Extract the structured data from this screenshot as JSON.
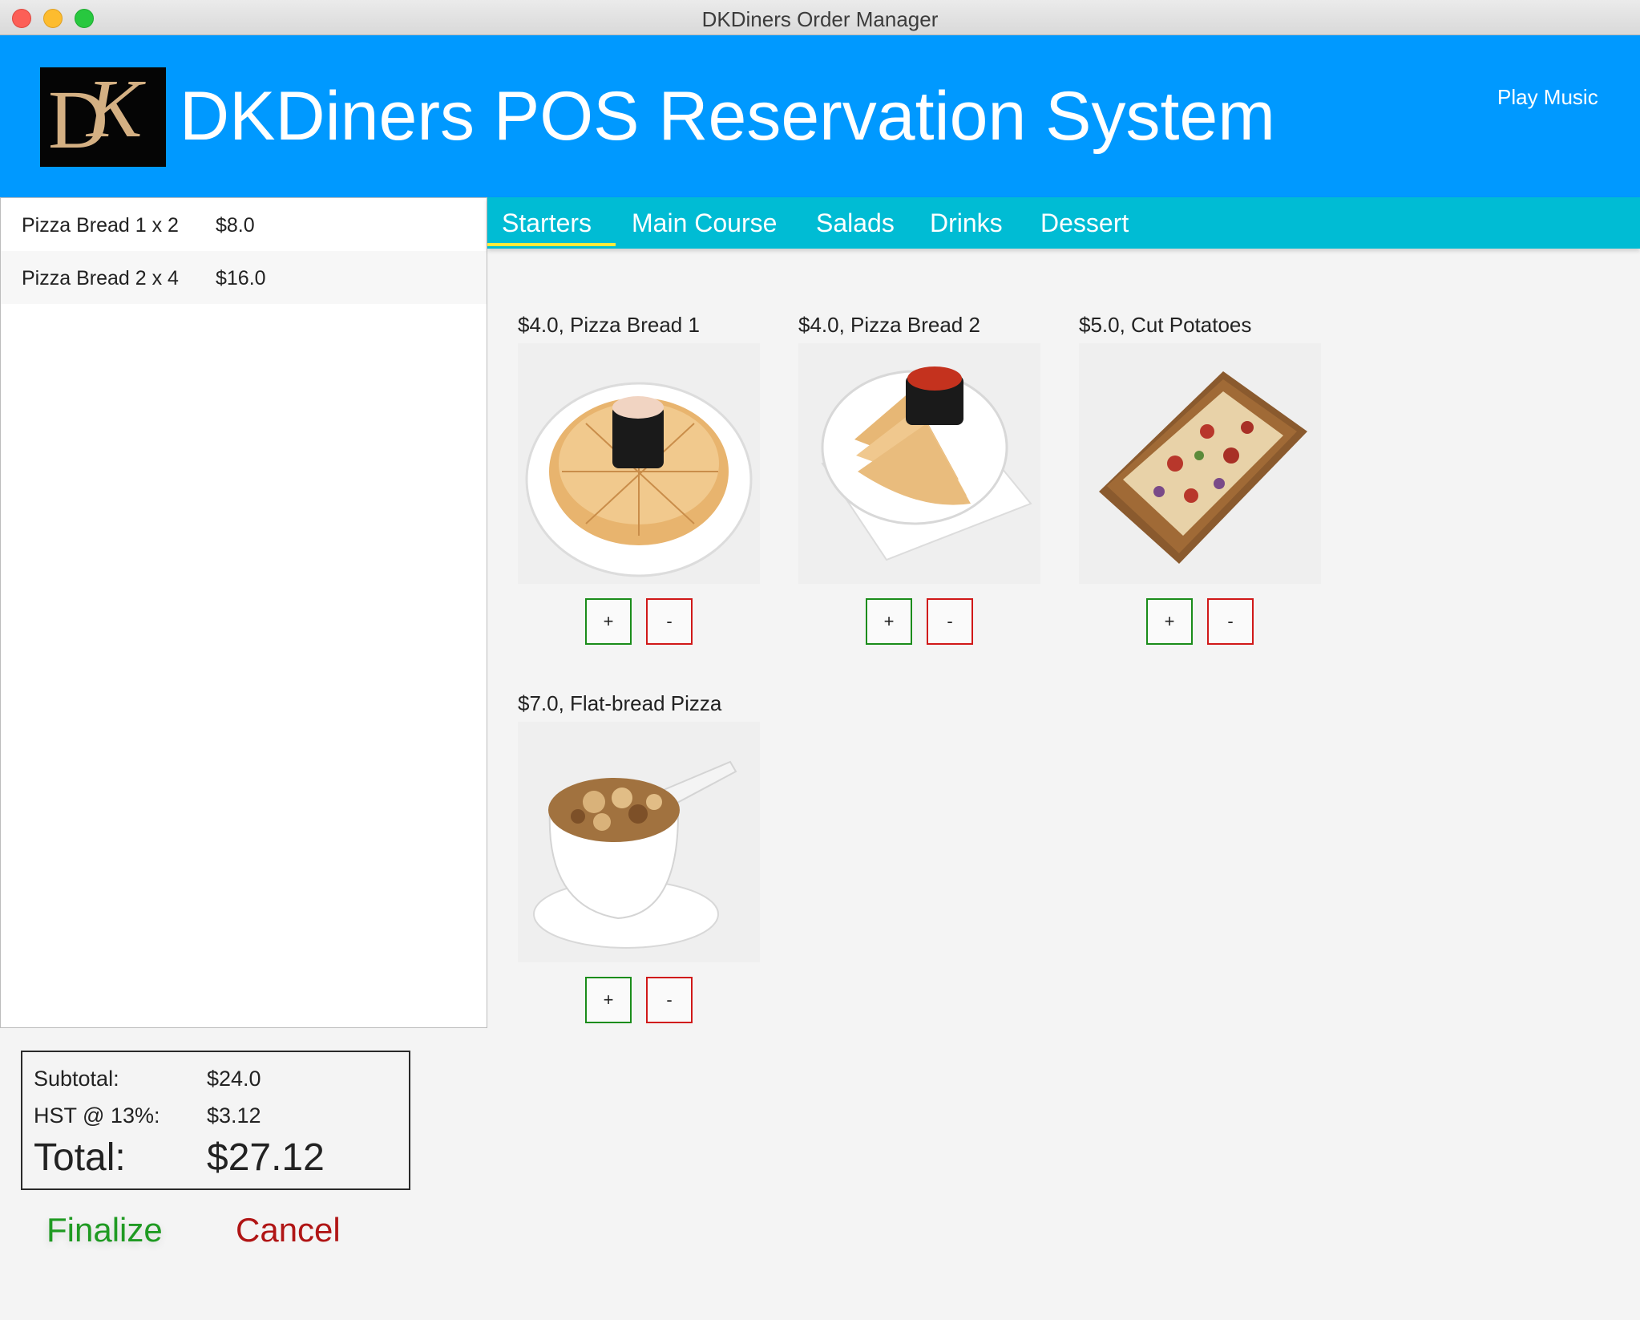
{
  "window": {
    "title": "DKDiners Order Manager"
  },
  "header": {
    "logo_letters": "DK",
    "title": "DKDiners POS Reservation System",
    "play_music_label": "Play Music"
  },
  "order": {
    "items": [
      {
        "name": "Pizza Bread 1 x 2",
        "price": "$8.0"
      },
      {
        "name": "Pizza Bread 2 x 4",
        "price": "$16.0"
      }
    ]
  },
  "totals": {
    "subtotal_label": "Subtotal:",
    "subtotal_value": "$24.0",
    "tax_label": "HST @ 13%:",
    "tax_value": "$3.12",
    "total_label": "Total:",
    "total_value": "$27.12"
  },
  "actions": {
    "finalize_label": "Finalize",
    "cancel_label": "Cancel"
  },
  "tabs": [
    {
      "label": "Starters",
      "selected": true
    },
    {
      "label": "Main Course",
      "selected": false
    },
    {
      "label": "Salads",
      "selected": false
    },
    {
      "label": "Drinks",
      "selected": false
    },
    {
      "label": "Dessert",
      "selected": false
    }
  ],
  "menu": [
    {
      "label": "$4.0, Pizza Bread 1",
      "image": "pizza-bread-1-photo",
      "plus": "+",
      "minus": "-"
    },
    {
      "label": "$4.0, Pizza Bread 2",
      "image": "pizza-bread-2-photo",
      "plus": "+",
      "minus": "-"
    },
    {
      "label": "$5.0, Cut Potatoes",
      "image": "cut-potatoes-photo",
      "plus": "+",
      "minus": "-"
    },
    {
      "label": "$7.0, Flat-bread Pizza",
      "image": "flat-bread-pizza-photo",
      "plus": "+",
      "minus": "-"
    }
  ],
  "colors": {
    "header": "#0099ff",
    "tabbar": "#00bcd4",
    "tab_indicator": "#ffeb3b",
    "finalize": "#1f9a22",
    "cancel": "#b01515"
  }
}
